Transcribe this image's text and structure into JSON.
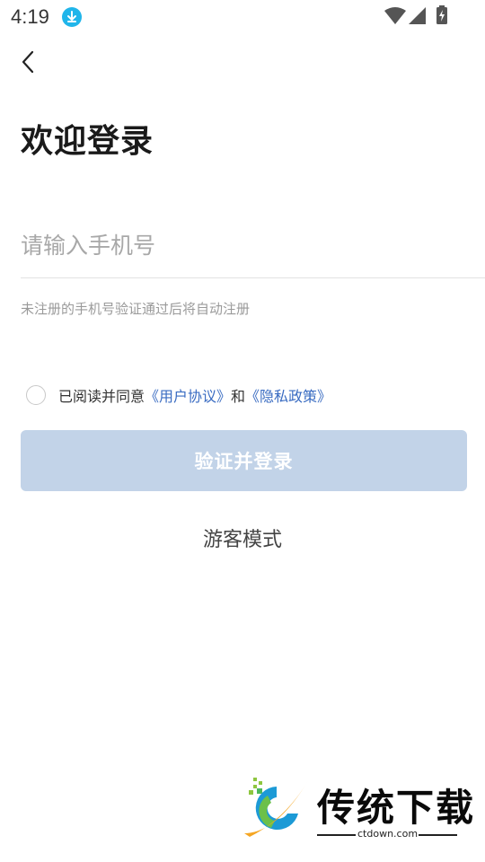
{
  "status_bar": {
    "time": "4:19",
    "icons": [
      "download-icon",
      "wifi-icon",
      "signal-icon",
      "battery-icon"
    ]
  },
  "header": {
    "back_icon": "chevron-left-icon"
  },
  "title": "欢迎登录",
  "phone": {
    "placeholder": "请输入手机号",
    "value": ""
  },
  "hint": "未注册的手机号验证通过后将自动注册",
  "agreement": {
    "prefix": "已阅读并同意",
    "user_agreement": "《用户协议》",
    "conjunction": "和",
    "privacy_policy": "《隐私政策》",
    "checked": false
  },
  "login_button": "验证并登录",
  "guest_mode": "游客模式",
  "watermark": {
    "name": "传统下载",
    "domain": "ctdown.com"
  },
  "colors": {
    "accent_link": "#3a6cc2",
    "button_disabled": "#c2d3e8",
    "download_badge": "#20b5ea"
  }
}
